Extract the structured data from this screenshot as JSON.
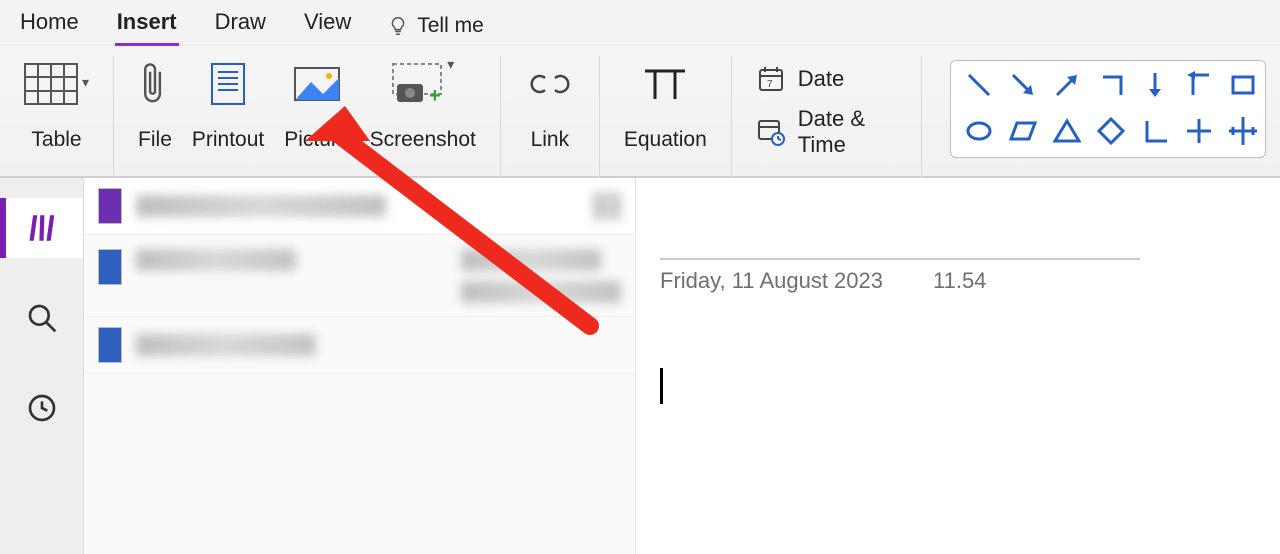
{
  "tabs": {
    "home": "Home",
    "insert": "Insert",
    "draw": "Draw",
    "view": "View",
    "tellme": "Tell me",
    "active": "insert"
  },
  "ribbon": {
    "table": "Table",
    "file": "File",
    "printout": "Printout",
    "picture": "Picture",
    "screenshot": "Screenshot",
    "link": "Link",
    "equation": "Equation",
    "date": "Date",
    "datetime": "Date & Time"
  },
  "shapes_gallery": {
    "row1": [
      "line-diag-down",
      "arrow-se",
      "arrow-ne",
      "corner-tr",
      "arrow-down",
      "turn-left-down",
      "rect-outline"
    ],
    "row2": [
      "ellipse",
      "parallelogram",
      "triangle",
      "diamond",
      "l-axes",
      "plus-axes",
      "xy-axes-big"
    ]
  },
  "sidebar": {
    "items": [
      "notebooks-icon",
      "search-icon",
      "clock-icon"
    ],
    "active_index": 0
  },
  "pages": {
    "entries": [
      {
        "color": "#6c2eb3",
        "redacted": true
      },
      {
        "color": "#2f5fbf",
        "redacted": true
      },
      {
        "color": "#2f5fbf",
        "redacted": true
      }
    ],
    "selected_index": 0
  },
  "canvas": {
    "title": "",
    "date": "Friday, 11 August 2023",
    "time": "11.54"
  },
  "annotation": {
    "arrow_color": "#ee2a1f",
    "points_to": "picture-button"
  }
}
